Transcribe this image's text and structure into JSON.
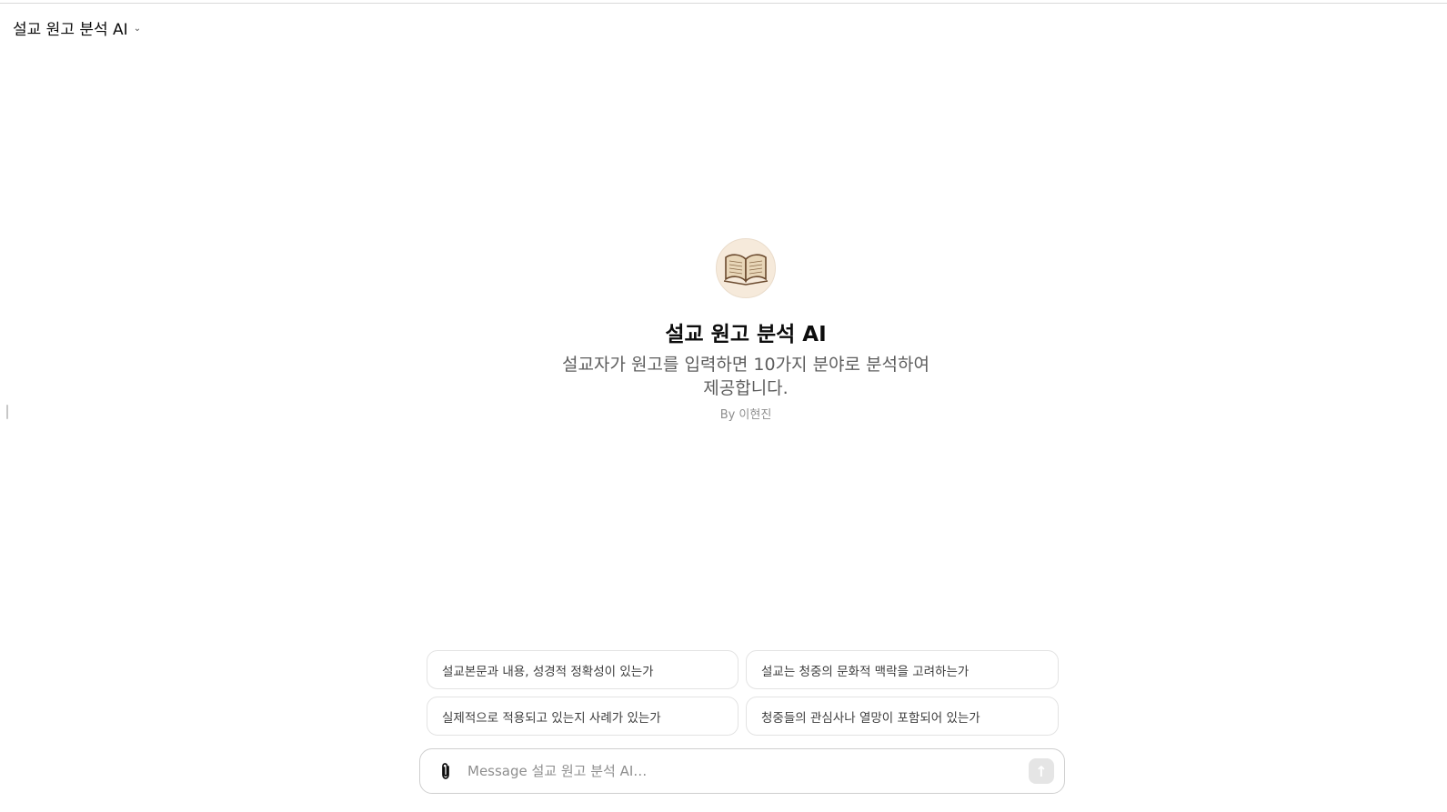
{
  "header": {
    "title": "설교 원고 분석 AI",
    "chevron_icon": "chevron-down-icon"
  },
  "gpt": {
    "avatar_icon": "open-book-icon",
    "title": "설교 원고 분석 AI",
    "description": "설교자가 원고를 입력하면 10가지 분야로 분석하여 제공합니다.",
    "author": "By 이현진"
  },
  "starters": [
    "설교본문과 내용, 성경적 정확성이 있는가",
    "설교는 청중의 문화적 맥락을 고려하는가",
    "실제적으로 적용되고 있는지 사례가 있는가",
    "청중들의 관심사나 열망이 포함되어 있는가"
  ],
  "composer": {
    "placeholder": "Message 설교 원고 분석 AI…",
    "value": "",
    "attach_icon": "paperclip-icon",
    "send_icon": "arrow-up-icon"
  },
  "colors": {
    "send_disabled": "#e5e5e5",
    "border": "#e3e3e3",
    "muted_text": "#5d5d5d"
  }
}
